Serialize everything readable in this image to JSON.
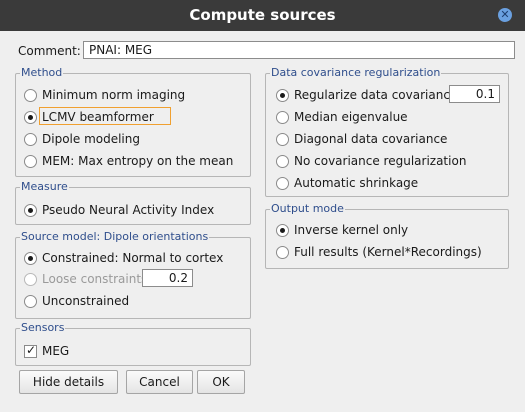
{
  "window": {
    "title": "Compute sources"
  },
  "comment": {
    "label": "Comment:",
    "value": "PNAI: MEG"
  },
  "method": {
    "title": "Method",
    "options": [
      {
        "label": "Minimum norm imaging",
        "selected": false
      },
      {
        "label": "LCMV beamformer",
        "selected": true
      },
      {
        "label": "Dipole modeling",
        "selected": false
      },
      {
        "label": "MEM: Max entropy on the mean",
        "selected": false
      }
    ]
  },
  "measure": {
    "title": "Measure",
    "options": [
      {
        "label": "Pseudo Neural Activity Index",
        "selected": true
      }
    ]
  },
  "source_model": {
    "title": "Source model: Dipole orientations",
    "options": [
      {
        "label": "Constrained:  Normal to cortex",
        "selected": true,
        "enabled": true
      },
      {
        "label": "Loose constraints",
        "selected": false,
        "enabled": false
      },
      {
        "label": "Unconstrained",
        "selected": false,
        "enabled": true
      }
    ],
    "loose_value": "0.2"
  },
  "sensors": {
    "title": "Sensors",
    "items": [
      {
        "label": "MEG",
        "checked": true
      }
    ]
  },
  "covariance": {
    "title": "Data covariance regularization",
    "options": [
      {
        "label": "Regularize data covariance:",
        "selected": true
      },
      {
        "label": "Median eigenvalue",
        "selected": false
      },
      {
        "label": "Diagonal data covariance",
        "selected": false
      },
      {
        "label": "No covariance regularization",
        "selected": false
      },
      {
        "label": "Automatic shrinkage",
        "selected": false
      }
    ],
    "regularize_value": "0.1"
  },
  "output_mode": {
    "title": "Output mode",
    "options": [
      {
        "label": "Inverse kernel only",
        "selected": true
      },
      {
        "label": "Full results (Kernel*Recordings)",
        "selected": false
      }
    ]
  },
  "buttons": {
    "hide_details": "Hide details",
    "cancel": "Cancel",
    "ok": "OK"
  },
  "colors": {
    "titlebar": "#3a3a3a",
    "group_title": "#2f4e8c",
    "focus_outline": "#f0a030",
    "close_icon": "#6aa0e0"
  }
}
